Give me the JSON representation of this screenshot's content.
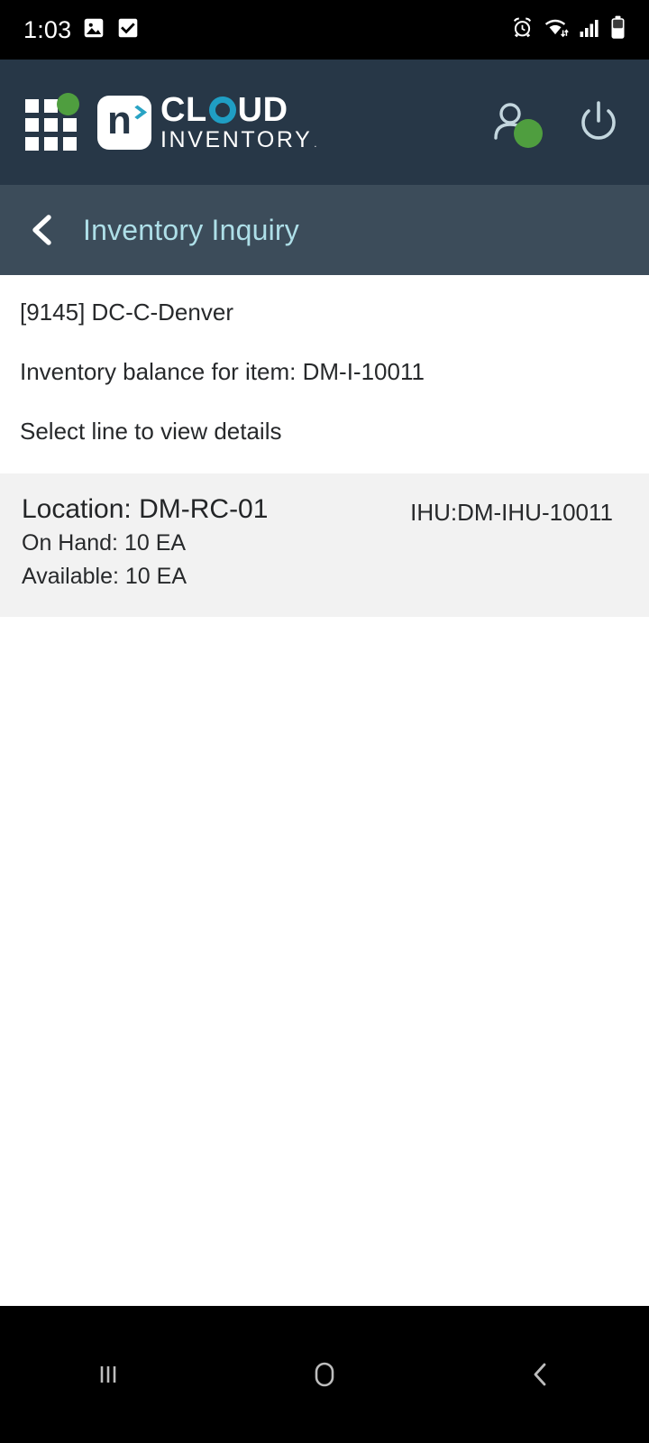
{
  "status_bar": {
    "time": "1:03",
    "left_icons": [
      "image-icon",
      "checkbox-checked-icon"
    ],
    "right_icons": [
      "alarm-icon",
      "wifi-icon",
      "signal-icon",
      "battery-icon"
    ]
  },
  "header": {
    "logo_grid": "app-grid-icon",
    "brand_letter": "n",
    "brand_top": "CLOUD",
    "brand_bottom": "INVENTORY",
    "brand_trademark": ".",
    "user_icon": "user-icon",
    "power_icon": "power-icon",
    "colors": {
      "header_bg": "#273747",
      "title_bg": "#3c4c5a",
      "accent_green": "#4f9e3f",
      "accent_teal": "#1f9ec4",
      "title_text": "#aedfe8",
      "card_bg": "#f2f2f2"
    }
  },
  "title_bar": {
    "back_label": "back-chevron",
    "title": "Inventory Inquiry"
  },
  "main": {
    "site_line": "[9145] DC-C-Denver",
    "balance_line": "Inventory balance for item: DM-I-10011",
    "instruction_line": "Select line to view details",
    "rows": [
      {
        "location": "Location: DM-RC-01",
        "on_hand": "On Hand: 10 EA",
        "available": "Available: 10 EA",
        "ihu": "IHU:DM-IHU-10011"
      }
    ]
  },
  "nav_bar": {
    "recents": "recents-icon",
    "home": "home-icon",
    "back": "back-icon"
  }
}
